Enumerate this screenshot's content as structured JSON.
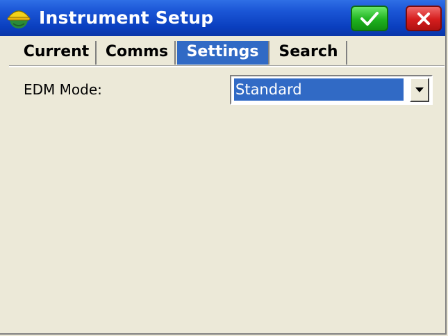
{
  "window": {
    "title": "Instrument Setup",
    "app_icon": "helmet-globe-icon",
    "ok_icon": "checkmark-icon",
    "close_icon": "close-icon"
  },
  "tabs": [
    {
      "label": "Current",
      "active": false
    },
    {
      "label": "Comms",
      "active": false
    },
    {
      "label": "Settings",
      "active": true
    },
    {
      "label": "Search",
      "active": false
    }
  ],
  "settings": {
    "edm_mode_label": "EDM Mode:",
    "edm_mode_value": "Standard"
  },
  "colors": {
    "titlebar": "#1b56d6",
    "selection": "#316ac5",
    "ok_button": "#1fb21f",
    "close_button": "#d51d1d",
    "background": "#ece9d8"
  }
}
